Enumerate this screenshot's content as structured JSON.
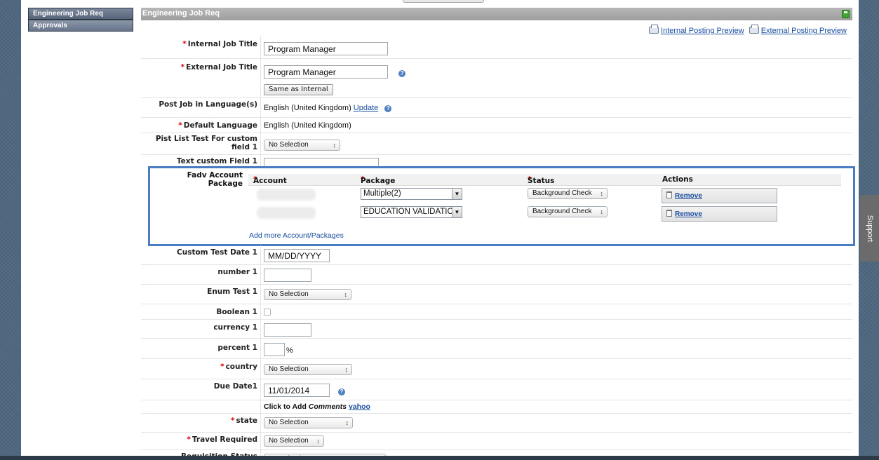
{
  "nav": {
    "items": [
      "Engineering Job Req",
      "Approvals"
    ]
  },
  "panel": {
    "title": "Engineering Job Req",
    "internal_preview": "Internal Posting Preview",
    "external_preview": "External Posting Preview"
  },
  "fields": {
    "internal_title": {
      "label": "Internal Job Title",
      "value": "Program Manager"
    },
    "external_title": {
      "label": "External Job Title",
      "value": "Program Manager",
      "same_button": "Same as Internal"
    },
    "post_language": {
      "label": "Post Job in Language(s)",
      "value": "English (United Kingdom)",
      "update": "Update"
    },
    "default_language": {
      "label": "Default Language",
      "value": "English (United Kingdom)"
    },
    "pist_list": {
      "label_l1": "Pist List Test For custom",
      "label_l2": "field 1",
      "value": "No Selection"
    },
    "text_custom": {
      "label": "Text custom Field 1",
      "value": ""
    },
    "fadv": {
      "label": "Fadv Account Package",
      "headers": {
        "account": "Account",
        "package": "Package",
        "status": "Status",
        "actions": "Actions"
      },
      "rows": [
        {
          "package": "Multiple(2)",
          "status": "Background Check",
          "action": "Remove"
        },
        {
          "package": "EDUCATION VALIDATIC",
          "status": "Background Check",
          "action": "Remove"
        }
      ],
      "add_more": "Add more Account/Packages"
    },
    "custom_date": {
      "label": "Custom Test Date 1",
      "value": "MM/DD/YYYY"
    },
    "number1": {
      "label": "number 1",
      "value": ""
    },
    "enum_test": {
      "label": "Enum Test 1",
      "value": "No Selection"
    },
    "boolean1": {
      "label": "Boolean 1",
      "checked": false
    },
    "currency1": {
      "label": "currency 1",
      "value": ""
    },
    "percent1": {
      "label": "percent 1",
      "value": "",
      "unit": "%"
    },
    "country": {
      "label": "country",
      "value": "No Selection"
    },
    "due_date": {
      "label": "Due Date1",
      "value": "11/01/2014"
    },
    "comments": {
      "text": "Click to Add",
      "italic": "Comments",
      "link": "yahoo"
    },
    "state": {
      "label": "state",
      "value": "No Selection"
    },
    "travel": {
      "label": "Travel Required",
      "value": "No Selection"
    },
    "req_status": {
      "label": "Requisition Status",
      "value": "No Selection"
    }
  },
  "support": "Support"
}
